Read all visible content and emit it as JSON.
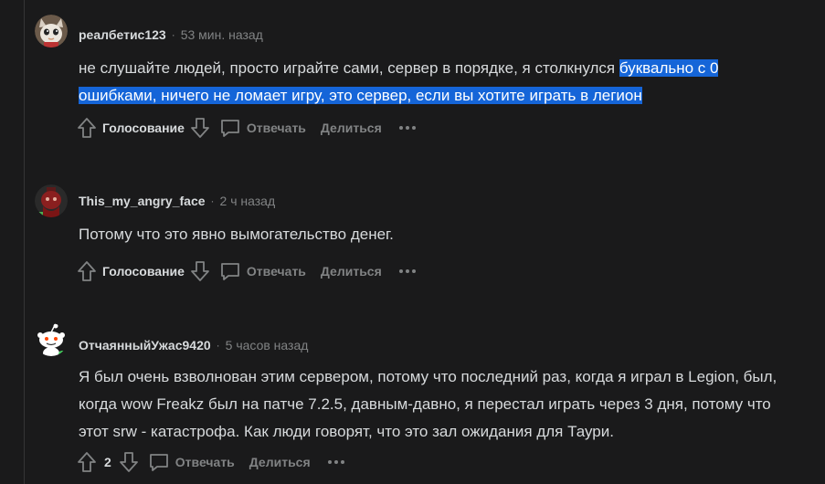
{
  "colors": {
    "background": "#1a1a1b",
    "text": "#d7dadc",
    "muted": "#818384",
    "selection": "#1565d8"
  },
  "comments": [
    {
      "username": "реалбетис123",
      "separator": "·",
      "time": "53 мин. назад",
      "avatar_icon": "cat-avatar",
      "lines": [
        {
          "plain": "не слушайте людей, просто играйте сами, сервер в порядке, я столкнулся ",
          "highlight": "буквально с 0"
        },
        {
          "plain": "",
          "highlight": "ошибками, ничего не ломает игру, это сервер, если вы хотите играть в легион"
        }
      ],
      "vote_label": "Голосование",
      "reply_label": "Отвечать",
      "share_label": "Делиться"
    },
    {
      "username": "This_my_angry_face",
      "separator": "·",
      "time": "2 ч назад",
      "avatar_icon": "red-character-avatar",
      "lines": [
        {
          "plain": "Потому что это явно вымогательство денег.",
          "highlight": ""
        }
      ],
      "vote_label": "Голосование",
      "reply_label": "Отвечать",
      "share_label": "Делиться"
    },
    {
      "username": "ОтчаянныйУжас9420",
      "separator": "·",
      "time": "5 часов назад",
      "avatar_icon": "snoo-avatar",
      "lines": [
        {
          "plain": "Я был очень взволнован этим сервером, потому что последний раз, когда я играл в Legion, был,",
          "highlight": ""
        },
        {
          "plain": "когда wow Freakz был на патче 7.2.5, давным-давно, я перестал играть через 3 дня, потому что",
          "highlight": ""
        },
        {
          "plain": "этот srw - катастрофа. Как люди говорят, что это зал ожидания для Таури.",
          "highlight": ""
        }
      ],
      "vote_label": "2",
      "reply_label": "Отвечать",
      "share_label": "Делиться"
    }
  ]
}
